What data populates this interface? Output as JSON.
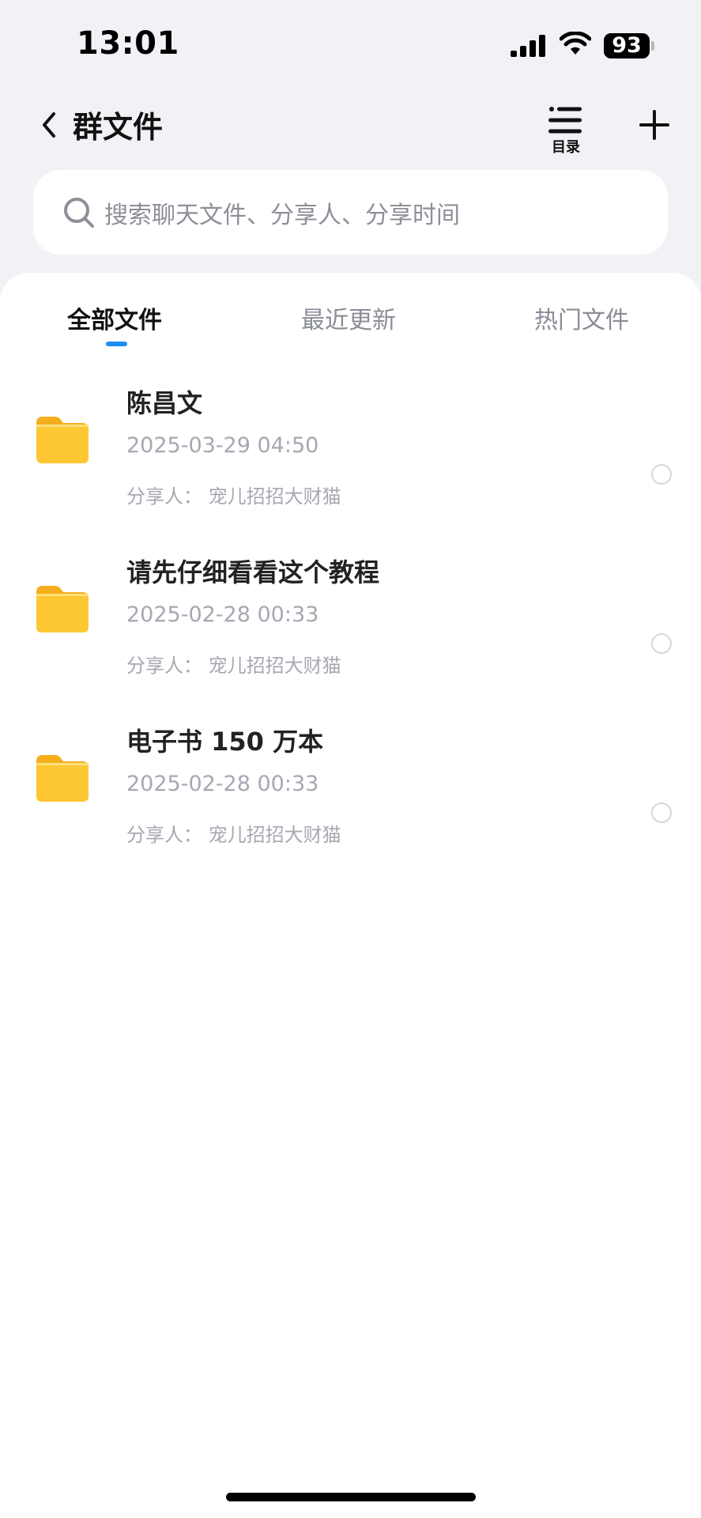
{
  "status_bar": {
    "time": "13:01",
    "battery": "93"
  },
  "nav": {
    "title": "群文件",
    "catalog_label": "目录"
  },
  "search": {
    "placeholder": "搜索聊天文件、分享人、分享时间"
  },
  "tabs": [
    {
      "label": "全部文件",
      "active": true
    },
    {
      "label": "最近更新",
      "active": false
    },
    {
      "label": "热门文件",
      "active": false
    }
  ],
  "files": [
    {
      "name": "陈昌文",
      "date": "2025-03-29 04:50",
      "sharer": "分享人：  宠儿招招大财猫",
      "icon": "folder-icon"
    },
    {
      "name": "请先仔细看看这个教程",
      "date": "2025-02-28 00:33",
      "sharer": "分享人：  宠儿招招大财猫",
      "icon": "folder-icon"
    },
    {
      "name": "电子书 150 万本",
      "date": "2025-02-28 00:33",
      "sharer": "分享人：  宠儿招招大财猫",
      "icon": "folder-icon"
    }
  ],
  "colors": {
    "accent": "#1e8cf5",
    "folder": "#fdc733",
    "background": "#f1f2f6"
  }
}
